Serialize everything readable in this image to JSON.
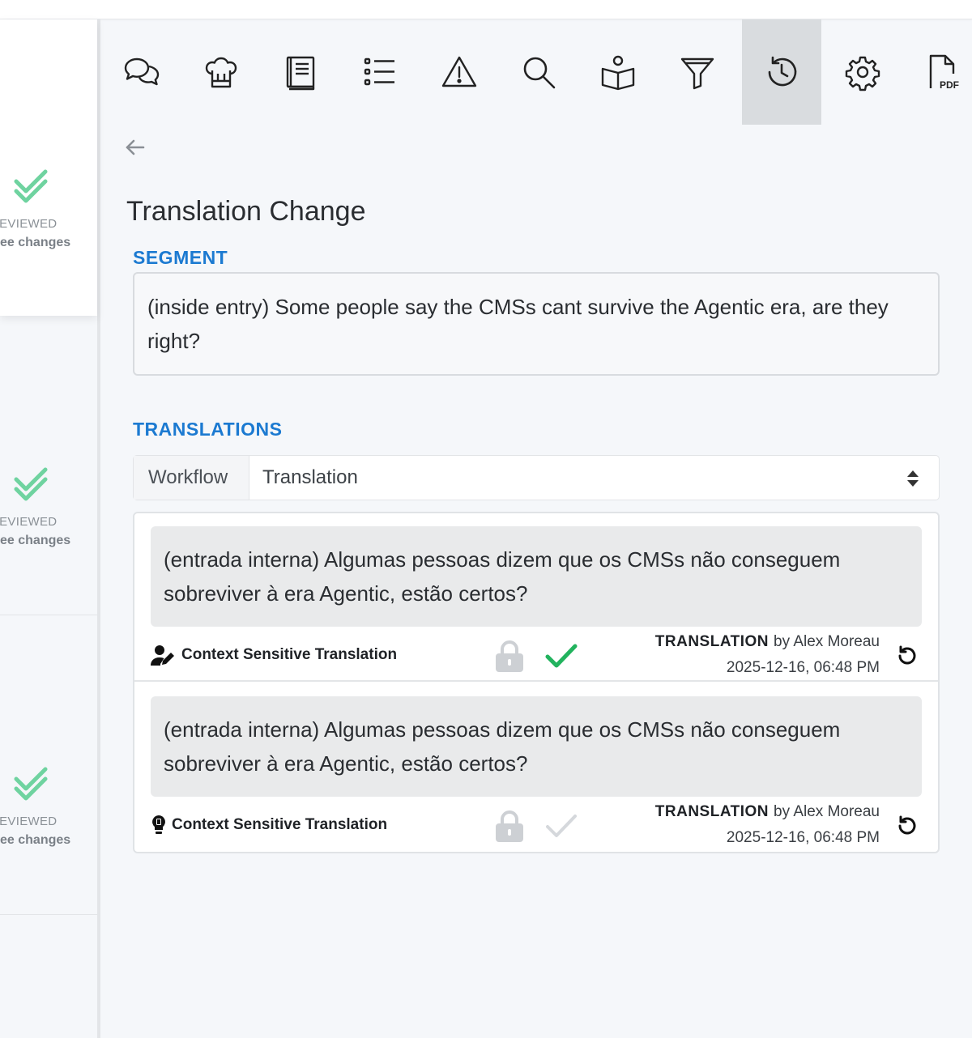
{
  "left_panel": {
    "cards": [
      {
        "status": "REVIEWED",
        "link": "ee changes"
      },
      {
        "status": "REVIEWED",
        "link": "ee changes"
      },
      {
        "status": "REVIEWED",
        "link": "ee changes"
      }
    ],
    "check_color": "#6fd3a0"
  },
  "toolbar": {
    "icons": [
      "comments-icon",
      "chef-hat-icon",
      "book-icon",
      "list-icon",
      "warning-icon",
      "search-icon",
      "reader-icon",
      "filter-icon",
      "history-icon",
      "settings-icon",
      "pdf-icon"
    ],
    "active": "history-icon",
    "pdf_label": "PDF"
  },
  "page": {
    "title": "Translation Change",
    "segment_heading": "SEGMENT",
    "segment_text": "(inside entry) Some people say the CMSs cant survive the Agentic era, are they right?",
    "translations_heading": "TRANSLATIONS",
    "accent_color": "#1c7ad1"
  },
  "workflow": {
    "label": "Workflow",
    "selected": "Translation"
  },
  "translations": [
    {
      "text": "(entrada interna) Algumas pessoas dizem que os CMSs não conseguem sobreviver à era Agentic, estão certos?",
      "context": "Context Sensitive Translation",
      "context_icon": "user-edit-icon",
      "step": "TRANSLATION",
      "by": "by Alex Moreau",
      "date": "2025-12-16, 06:48 PM",
      "approved": true,
      "approved_color": "#22b35e"
    },
    {
      "text": "(entrada interna) Algumas pessoas dizem que os CMSs não conseguem sobreviver à era Agentic, estão certos?",
      "context": "Context Sensitive Translation",
      "context_icon": "lightbulb-icon",
      "step": "TRANSLATION",
      "by": "by Alex Moreau",
      "date": "2025-12-16, 06:48 PM",
      "approved": false,
      "approved_color": "#d5d8dc"
    }
  ]
}
